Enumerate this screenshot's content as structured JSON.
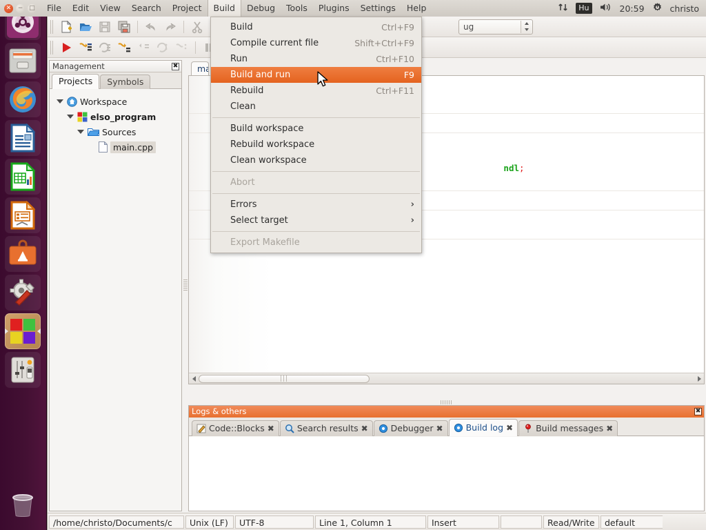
{
  "top_panel": {
    "window_buttons": [
      "close",
      "minimize",
      "maximize"
    ],
    "menus": [
      "File",
      "Edit",
      "View",
      "Search",
      "Project",
      "Build",
      "Debug",
      "Tools",
      "Plugins",
      "Settings",
      "Help"
    ],
    "active_menu": "Build",
    "tray": {
      "network_icon": "network-updown-icon",
      "keyboard_layout": "Hu",
      "volume_icon": "volume-icon",
      "clock": "20:59",
      "session_icon": "gear-power-icon",
      "user": "christo"
    }
  },
  "launcher": {
    "items": [
      {
        "name": "ubuntu-dash-icon",
        "label": "Dash home"
      },
      {
        "name": "files-icon",
        "label": "Files"
      },
      {
        "name": "firefox-icon",
        "label": "Firefox Web Browser"
      },
      {
        "name": "libreoffice-writer-icon",
        "label": "LibreOffice Writer"
      },
      {
        "name": "libreoffice-calc-icon",
        "label": "LibreOffice Calc"
      },
      {
        "name": "libreoffice-impress-icon",
        "label": "LibreOffice Impress"
      },
      {
        "name": "ubuntu-software-icon",
        "label": "Ubuntu Software"
      },
      {
        "name": "system-settings-icon",
        "label": "System Settings"
      },
      {
        "name": "codeblocks-icon",
        "label": "Code::Blocks"
      },
      {
        "name": "amixer-icon",
        "label": "Sound Mixer"
      },
      {
        "name": "trash-icon",
        "label": "Trash"
      }
    ]
  },
  "toolbar": {
    "row1": [
      {
        "name": "new-file-icon"
      },
      {
        "name": "open-file-icon"
      },
      {
        "name": "save-icon"
      },
      {
        "name": "save-all-icon"
      },
      {
        "name": "undo-icon"
      },
      {
        "name": "redo-icon"
      },
      {
        "name": "cut-icon"
      },
      {
        "name": "copy-icon"
      }
    ],
    "row2": [
      {
        "name": "run-icon"
      },
      {
        "name": "build-icon"
      },
      {
        "name": "rebuild-icon"
      },
      {
        "name": "build-and-run-icon"
      },
      {
        "name": "abort-icon"
      },
      {
        "name": "compile-current-icon"
      },
      {
        "name": "clean-icon"
      },
      {
        "name": "pause-icon"
      }
    ],
    "target_combo_value": "ug",
    "target_combo_full": "Debug"
  },
  "management": {
    "title": "Management",
    "close_icon": "close-icon",
    "tabs": [
      {
        "label": "Projects",
        "selected": true
      },
      {
        "label": "Symbols",
        "selected": false
      }
    ],
    "tree": [
      {
        "label": "Workspace",
        "icon": "workspace-icon",
        "depth": 0,
        "expanded": true,
        "bold": false,
        "selected": false
      },
      {
        "label": "elso_program",
        "icon": "project-icon",
        "depth": 1,
        "expanded": true,
        "bold": true,
        "selected": false
      },
      {
        "label": "Sources",
        "icon": "folder-icon",
        "depth": 2,
        "expanded": true,
        "bold": false,
        "selected": false
      },
      {
        "label": "main.cpp",
        "icon": "file-icon",
        "depth": 3,
        "expanded": false,
        "bold": false,
        "selected": true
      }
    ]
  },
  "editor": {
    "tabs": [
      {
        "label": "ma",
        "full_label": "main.cpp",
        "selected": true
      }
    ],
    "code_fragment": "ndl",
    "code_terminator": ";",
    "hscroll_grip": "|||"
  },
  "build_menu": {
    "items": [
      {
        "label": "Build",
        "accel": "Ctrl+F9",
        "type": "item",
        "selected": false,
        "disabled": false
      },
      {
        "label": "Compile current file",
        "accel": "Shift+Ctrl+F9",
        "type": "item",
        "selected": false,
        "disabled": false
      },
      {
        "label": "Run",
        "accel": "Ctrl+F10",
        "type": "item",
        "selected": false,
        "disabled": false
      },
      {
        "label": "Build and run",
        "accel": "F9",
        "type": "item",
        "selected": true,
        "disabled": false
      },
      {
        "label": "Rebuild",
        "accel": "Ctrl+F11",
        "type": "item",
        "selected": false,
        "disabled": false
      },
      {
        "label": "Clean",
        "accel": "",
        "type": "item",
        "selected": false,
        "disabled": false
      },
      {
        "type": "separator"
      },
      {
        "label": "Build workspace",
        "accel": "",
        "type": "item",
        "selected": false,
        "disabled": false
      },
      {
        "label": "Rebuild workspace",
        "accel": "",
        "type": "item",
        "selected": false,
        "disabled": false
      },
      {
        "label": "Clean workspace",
        "accel": "",
        "type": "item",
        "selected": false,
        "disabled": false
      },
      {
        "type": "separator"
      },
      {
        "label": "Abort",
        "accel": "",
        "type": "item",
        "selected": false,
        "disabled": true
      },
      {
        "type": "separator"
      },
      {
        "label": "Errors",
        "accel": "",
        "type": "submenu",
        "selected": false,
        "disabled": false,
        "arrow": "›"
      },
      {
        "label": "Select target",
        "accel": "",
        "type": "submenu",
        "selected": false,
        "disabled": false,
        "arrow": "›"
      },
      {
        "type": "separator"
      },
      {
        "label": "Export Makefile",
        "accel": "",
        "type": "item",
        "selected": false,
        "disabled": true
      }
    ]
  },
  "logs": {
    "title": "Logs & others",
    "close_icon": "close-icon",
    "tabs": [
      {
        "label": "Code::Blocks",
        "icon": "pencil-icon",
        "selected": false,
        "close": "✖"
      },
      {
        "label": "Search results",
        "icon": "magnifier-icon",
        "selected": false,
        "close": "✖"
      },
      {
        "label": "Debugger",
        "icon": "gear-blue-icon",
        "selected": false,
        "close": "✖"
      },
      {
        "label": "Build log",
        "icon": "gear-blue-icon",
        "selected": true,
        "close": "✖"
      },
      {
        "label": "Build messages",
        "icon": "pin-icon",
        "selected": false,
        "close": "✖"
      }
    ],
    "content": ""
  },
  "status_bar": {
    "fields": [
      {
        "name": "file-path",
        "value": "/home/christo/Documents/c",
        "width": 196
      },
      {
        "name": "line-endings",
        "value": "Unix (LF)",
        "width": 70
      },
      {
        "name": "encoding",
        "value": "UTF-8",
        "width": 114
      },
      {
        "name": "caret-position",
        "value": "Line 1, Column 1",
        "width": 161
      },
      {
        "name": "insert-mode",
        "value": "Insert",
        "width": 104
      },
      {
        "name": "modified-flag",
        "value": "",
        "width": 60
      },
      {
        "name": "read-write-mode",
        "value": "Read/Write",
        "width": 81
      },
      {
        "name": "personality",
        "value": "default",
        "width": 90
      }
    ]
  },
  "colors": {
    "menu_highlight": "#e4631f",
    "logs_header": "#e8702f",
    "launcher_bg": "#43102f",
    "panel_bg": "#f3f1ef",
    "code_keyword": "#19a319",
    "code_operator": "#e01b1b"
  }
}
